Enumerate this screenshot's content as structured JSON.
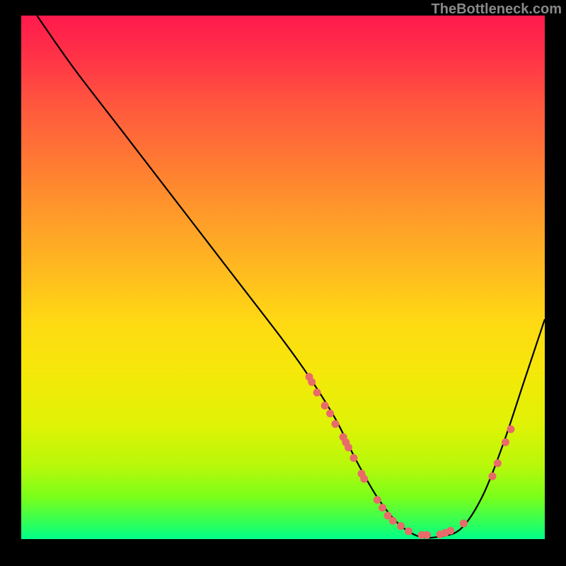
{
  "watermark": "TheBottleneck.com",
  "chart_data": {
    "type": "line",
    "title": "",
    "xlabel": "",
    "ylabel": "",
    "xlim": [
      0,
      100
    ],
    "ylim": [
      0,
      100
    ],
    "curve": {
      "x": [
        3,
        10,
        20,
        30,
        40,
        50,
        55,
        60,
        64,
        68,
        72,
        76,
        80,
        84,
        88,
        92,
        96,
        100
      ],
      "y": [
        100,
        90,
        77,
        64,
        51,
        38,
        31,
        23,
        15,
        8,
        3,
        0.5,
        0.5,
        2,
        8,
        18,
        30,
        42
      ]
    },
    "markers": [
      {
        "x": 55.0,
        "y": 31.0
      },
      {
        "x": 55.5,
        "y": 30.0
      },
      {
        "x": 56.5,
        "y": 28.0
      },
      {
        "x": 58.0,
        "y": 25.5
      },
      {
        "x": 59.0,
        "y": 24.0
      },
      {
        "x": 60.0,
        "y": 22.0
      },
      {
        "x": 61.5,
        "y": 19.5
      },
      {
        "x": 62.0,
        "y": 18.5
      },
      {
        "x": 62.5,
        "y": 17.5
      },
      {
        "x": 63.5,
        "y": 15.5
      },
      {
        "x": 65.0,
        "y": 12.5
      },
      {
        "x": 65.5,
        "y": 11.5
      },
      {
        "x": 68.0,
        "y": 7.5
      },
      {
        "x": 69.0,
        "y": 6.0
      },
      {
        "x": 70.0,
        "y": 4.5
      },
      {
        "x": 71.0,
        "y": 3.5
      },
      {
        "x": 72.5,
        "y": 2.5
      },
      {
        "x": 74.0,
        "y": 1.5
      },
      {
        "x": 76.5,
        "y": 0.8
      },
      {
        "x": 77.5,
        "y": 0.8
      },
      {
        "x": 80.0,
        "y": 0.9
      },
      {
        "x": 81.0,
        "y": 1.2
      },
      {
        "x": 82.0,
        "y": 1.6
      },
      {
        "x": 84.5,
        "y": 3.0
      },
      {
        "x": 90.0,
        "y": 12.0
      },
      {
        "x": 91.0,
        "y": 14.5
      },
      {
        "x": 92.5,
        "y": 18.5
      },
      {
        "x": 93.5,
        "y": 21.0
      }
    ],
    "gradient_stops": [
      {
        "pos": 0,
        "color": "#ff1a4d"
      },
      {
        "pos": 100,
        "color": "#00ff8a"
      }
    ]
  }
}
